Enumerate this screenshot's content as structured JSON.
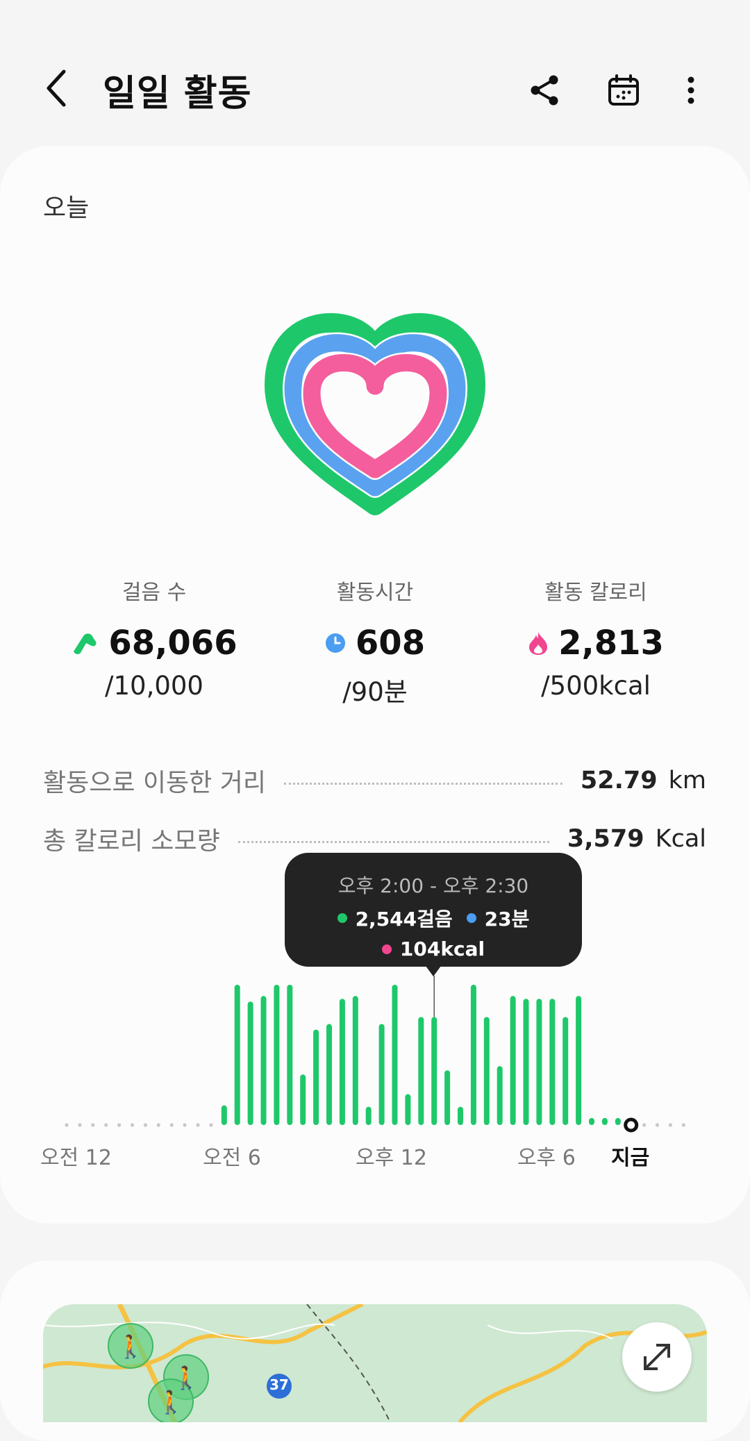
{
  "header": {
    "title": "일일 활동",
    "back_icon": "back-arrow-icon",
    "share_icon": "share-icon",
    "calendar_icon": "calendar-icon",
    "more_icon": "more-vertical-icon"
  },
  "summary": {
    "date_label": "오늘",
    "heart_rings": {
      "outer_color": "#1ec86a",
      "middle_color": "#5aa2f0",
      "inner_color": "#f45e9d"
    },
    "stats": [
      {
        "label": "걸음 수",
        "value": "68,066",
        "goal": "/10,000",
        "icon": "shoe-icon",
        "color": "#1ec86a"
      },
      {
        "label": "활동시간",
        "value": "608",
        "goal": "/90분",
        "icon": "clock-icon",
        "color": "#4a9df0"
      },
      {
        "label": "활동 칼로리",
        "value": "2,813",
        "goal": "/500kcal",
        "icon": "flame-icon",
        "color": "#f2458f"
      }
    ],
    "distance": {
      "label": "활동으로 이동한 거리",
      "value": "52.79",
      "unit": "km"
    },
    "total_calories": {
      "label": "총 칼로리 소모량",
      "value": "3,579",
      "unit": "Kcal"
    }
  },
  "tooltip": {
    "time": "오후 2:00 - 오후 2:30",
    "steps": "2,544걸음",
    "minutes": "23분",
    "kcal": "104kcal"
  },
  "chart_data": {
    "type": "bar",
    "x_labels": [
      "오전 12",
      "오전 6",
      "오후 12",
      "오후 6",
      "지금"
    ],
    "bar_color": "#1ec86a",
    "values": [
      0,
      0,
      0,
      0,
      0,
      0,
      0,
      0,
      0,
      0,
      0,
      0,
      0.14,
      1.0,
      0.88,
      0.92,
      1.0,
      1.0,
      0.36,
      0.68,
      0.72,
      0.9,
      0.92,
      0.13,
      0.72,
      1.0,
      0.22,
      0.77,
      0.77,
      0.39,
      0.13,
      1.0,
      0.77,
      0.42,
      0.92,
      0.9,
      0.9,
      0.9,
      0.77,
      0.92,
      0.05,
      0.05,
      0.05,
      0.05,
      0,
      0,
      0,
      0
    ],
    "highlight_index": 28,
    "now_index": 43
  },
  "map": {
    "road_marker": "37"
  }
}
